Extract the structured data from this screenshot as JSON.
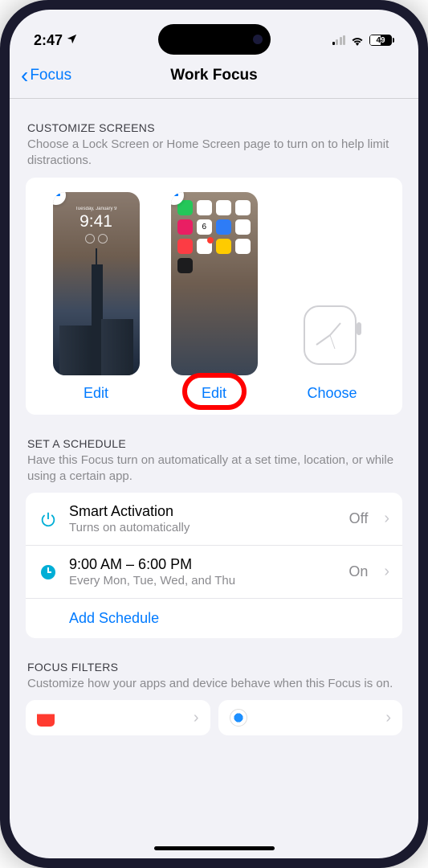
{
  "status": {
    "time": "2:47",
    "battery": "49"
  },
  "nav": {
    "back": "Focus",
    "title": "Work Focus"
  },
  "customize": {
    "header": "CUSTOMIZE SCREENS",
    "desc": "Choose a Lock Screen or Home Screen page to turn on to help limit distractions.",
    "lock_time": "9:41",
    "lock_date": "Tuesday, January 9",
    "home_cal_day": "6",
    "edit1": "Edit",
    "edit2": "Edit",
    "choose": "Choose"
  },
  "schedule": {
    "header": "SET A SCHEDULE",
    "desc": "Have this Focus turn on automatically at a set time, location, or while using a certain app.",
    "smart": {
      "title": "Smart Activation",
      "sub": "Turns on automatically",
      "value": "Off"
    },
    "time": {
      "title": "9:00 AM – 6:00 PM",
      "sub": "Every Mon, Tue, Wed, and Thu",
      "value": "On"
    },
    "add": "Add Schedule"
  },
  "filters": {
    "header": "FOCUS FILTERS",
    "desc": "Customize how your apps and device behave when this Focus is on."
  }
}
